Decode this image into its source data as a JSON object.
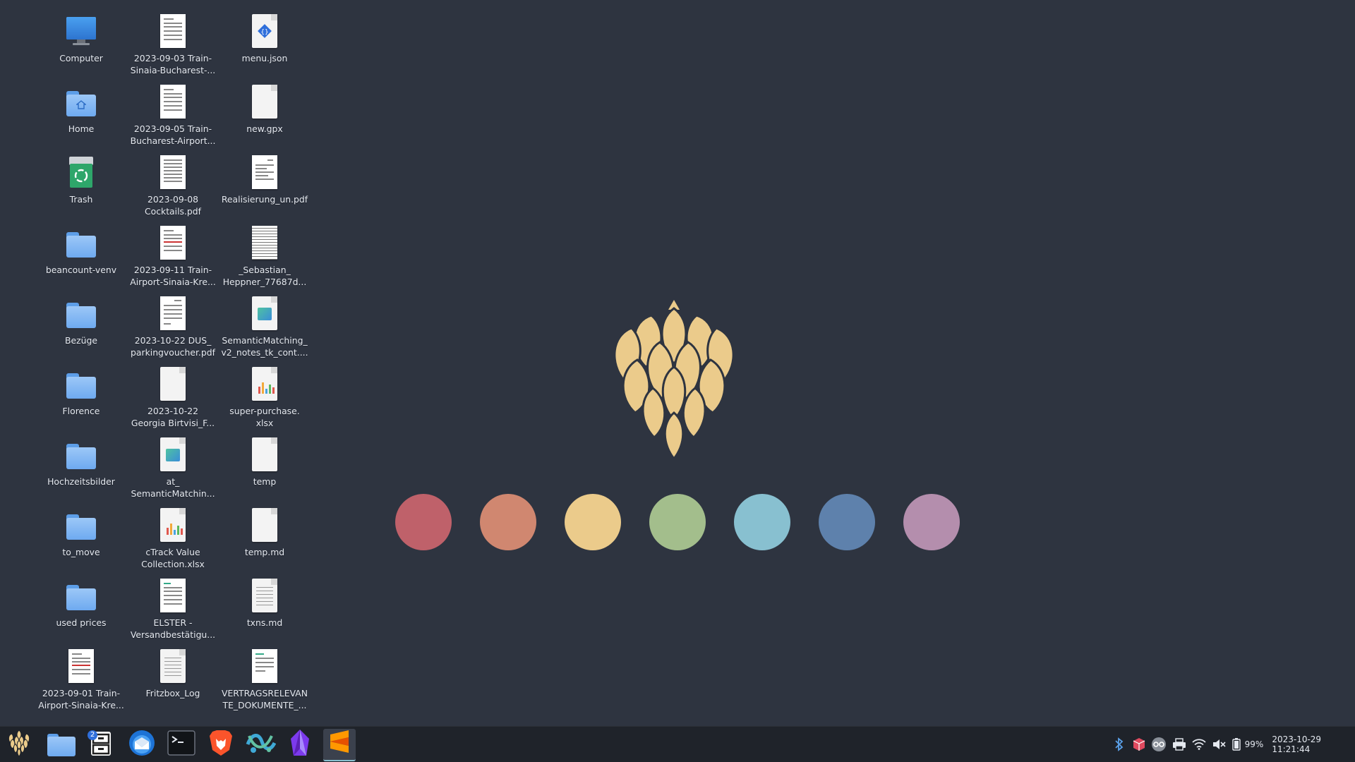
{
  "desktop": {
    "col1": [
      {
        "label": "Computer",
        "icon": "computer-icon"
      },
      {
        "label": "Home",
        "icon": "home-folder-icon"
      },
      {
        "label": "Trash",
        "icon": "trash-icon"
      },
      {
        "label": "beancount-venv",
        "icon": "folder-icon"
      },
      {
        "label": "Bezüge",
        "icon": "folder-icon"
      },
      {
        "label": "Florence",
        "icon": "folder-icon"
      },
      {
        "label": "Hochzeitsbilder",
        "icon": "folder-icon"
      },
      {
        "label": "to_move",
        "icon": "folder-icon"
      },
      {
        "label": "used prices",
        "icon": "folder-icon"
      },
      {
        "label": "2023-09-01 Train-Airport-Sinaia-Kre...",
        "icon": "pdf-thumbnail-icon"
      }
    ],
    "col2": [
      {
        "label": "2023-09-03 Train-Sinaia-Bucharest-...",
        "icon": "pdf-thumbnail-icon"
      },
      {
        "label": "2023-09-05 Train-Bucharest-Airport...",
        "icon": "pdf-thumbnail-icon"
      },
      {
        "label": "2023-09-08 Cocktails.pdf",
        "icon": "pdf-thumbnail-icon"
      },
      {
        "label": "2023-09-11 Train-Airport-Sinaia-Kre...",
        "icon": "pdf-thumbnail-icon"
      },
      {
        "label": "2023-10-22 DUS_ parkingvoucher.pdf",
        "icon": "pdf-thumbnail-icon"
      },
      {
        "label": "2023-10-22 Georgia Birtvisi_F...",
        "icon": "blank-file-icon"
      },
      {
        "label": "at_ SemanticMatchin...",
        "icon": "presentation-file-icon"
      },
      {
        "label": "cTrack Value Collection.xlsx",
        "icon": "spreadsheet-file-icon"
      },
      {
        "label": "ELSTER - Versandbestätigu...",
        "icon": "pdf-thumbnail-icon"
      },
      {
        "label": "Fritzbox_Log",
        "icon": "text-file-icon"
      }
    ],
    "col3": [
      {
        "label": "menu.json",
        "icon": "json-file-icon"
      },
      {
        "label": "new.gpx",
        "icon": "blank-file-icon"
      },
      {
        "label": "Realisierung_un.pdf",
        "icon": "pdf-thumbnail-icon"
      },
      {
        "label": "_Sebastian_ Heppner_77687d...",
        "icon": "pdf-thumbnail-icon"
      },
      {
        "label": "SemanticMatching_ v2_notes_tk_cont....",
        "icon": "presentation-file-icon"
      },
      {
        "label": "super-purchase. xlsx",
        "icon": "spreadsheet-file-icon"
      },
      {
        "label": "temp",
        "icon": "blank-file-icon"
      },
      {
        "label": "temp.md",
        "icon": "blank-file-icon"
      },
      {
        "label": "txns.md",
        "icon": "text-file-icon"
      },
      {
        "label": "VERTRAGSRELEVAN TE_DOKUMENTE_...",
        "icon": "pdf-thumbnail-icon"
      }
    ]
  },
  "wallpaper": {
    "logo": "hop-cone-logo",
    "dot_colors": [
      "#bf616a",
      "#d08770",
      "#ebcb8b",
      "#a3be8c",
      "#88c0d0",
      "#5e81ac",
      "#b48ead"
    ]
  },
  "taskbar": {
    "apps": [
      {
        "name": "app-menu-button",
        "icon": "hop-cone-icon"
      },
      {
        "name": "files-button",
        "icon": "folder-icon"
      },
      {
        "name": "file-manager-button",
        "icon": "file-cabinet-icon",
        "badge": "2"
      },
      {
        "name": "thunderbird-button",
        "icon": "mail-icon"
      },
      {
        "name": "terminal-button",
        "icon": "terminal-icon"
      },
      {
        "name": "brave-button",
        "icon": "brave-lion-icon"
      },
      {
        "name": "vscodium-button",
        "icon": "code-editor-icon"
      },
      {
        "name": "obsidian-button",
        "icon": "obsidian-gem-icon"
      },
      {
        "name": "sublime-text-button",
        "icon": "sublime-icon",
        "active": true
      }
    ],
    "tray": {
      "battery_percent": "99%",
      "datetime": "2023-10-29 11:21:44"
    },
    "accent": "#88c0d0"
  }
}
